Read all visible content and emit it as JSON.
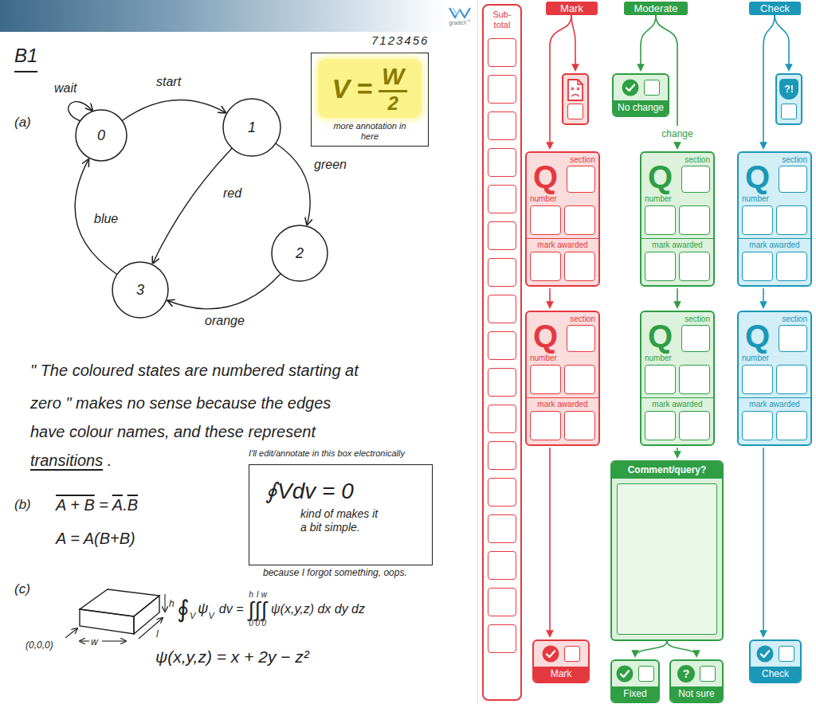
{
  "header": {
    "logo": "gradeX",
    "logo_mark": "™"
  },
  "script": {
    "question": "B1",
    "student_id": "7123456",
    "annotation": {
      "lhs": "V",
      "equals": "=",
      "numerator": "W",
      "denominator": "2",
      "note": "more annotation in here"
    },
    "part_a": {
      "label": "(a)",
      "states": [
        {
          "label": "0"
        },
        {
          "label": "1"
        },
        {
          "label": "2"
        },
        {
          "label": "3"
        }
      ],
      "transitions": [
        {
          "label": "wait",
          "from": "0",
          "to": "0"
        },
        {
          "label": "start",
          "from": "0",
          "to": "1"
        },
        {
          "label": "green",
          "from": "1",
          "to": "2"
        },
        {
          "label": "red",
          "from": "1",
          "to": "3"
        },
        {
          "label": "orange",
          "from": "2",
          "to": "3"
        },
        {
          "label": "blue",
          "from": "3",
          "to": "0"
        }
      ],
      "comment_lines": [
        [
          {
            "text": "\" The coloured states are numbered starting at",
            "underlined": false
          }
        ],
        [
          {
            "text": "zero \" makes no sense because the edges",
            "underlined": false
          }
        ],
        [
          {
            "text": "have colour names, and these represent",
            "underlined": false
          }
        ],
        [
          {
            "text": "transitions",
            "underlined": true
          },
          {
            "text": " .",
            "underlined": false
          }
        ]
      ]
    },
    "part_b": {
      "label": "(b)",
      "equations": [
        [
          {
            "text": "A + B",
            "overline": true
          },
          {
            "text": " = ",
            "overline": false
          },
          {
            "text": "A",
            "overline": true
          },
          {
            "text": ".",
            "overline": false
          },
          {
            "text": "B",
            "overline": true
          }
        ],
        [
          {
            "text": "A = A(B+B)",
            "overline": false
          }
        ]
      ]
    },
    "electronic_box": {
      "caption": "I'll edit/annotate in this box electronically",
      "formula": "∮Vdv = 0",
      "note_lines": [
        "kind of makes it",
        "a bit simple."
      ],
      "footnote": "because I forgot something, oops."
    },
    "part_c": {
      "label": "(c)",
      "origin": "(0,0,0)",
      "dims": {
        "width": "w",
        "height": "h",
        "length": "l"
      },
      "integral": {
        "sign": "∮",
        "domain": "V",
        "integrand": "ψ",
        "integrand_sub": "V",
        "differential": "dv =",
        "limits": [
          {
            "sign": "∫",
            "upper": "h",
            "lower": "0"
          },
          {
            "sign": "∫",
            "upper": "l",
            "lower": "0"
          },
          {
            "sign": "∫",
            "upper": "w",
            "lower": "0"
          }
        ],
        "body": "ψ(x,y,z) dx dy dz"
      },
      "definition": "ψ(x,y,z) = x + 2y − z²"
    }
  },
  "subtotal": {
    "title": "Sub-total",
    "boxes": [
      {
        "value": ""
      },
      {
        "value": ""
      },
      {
        "value": ""
      },
      {
        "value": ""
      },
      {
        "value": ""
      },
      {
        "value": ""
      },
      {
        "value": ""
      },
      {
        "value": ""
      },
      {
        "value": ""
      },
      {
        "value": ""
      },
      {
        "value": ""
      },
      {
        "value": ""
      },
      {
        "value": ""
      },
      {
        "value": ""
      },
      {
        "value": ""
      },
      {
        "value": ""
      },
      {
        "value": ""
      }
    ]
  },
  "mark": {
    "title": "Mark",
    "reject": {
      "checked": false
    },
    "questions": [
      {
        "section_label": "section",
        "letter": "Q",
        "number_label": "number",
        "mark_label": "mark awarded",
        "section": "",
        "number": [
          "",
          ""
        ],
        "mark": [
          "",
          ""
        ]
      },
      {
        "section_label": "section",
        "letter": "Q",
        "number_label": "number",
        "mark_label": "mark awarded",
        "section": "",
        "number": [
          "",
          ""
        ],
        "mark": [
          "",
          ""
        ]
      }
    ],
    "button": {
      "label": "Mark",
      "checked": false
    }
  },
  "moderate": {
    "title": "Moderate",
    "no_change": {
      "label": "No change",
      "checked": false
    },
    "change_label": "change",
    "questions": [
      {
        "section_label": "section",
        "letter": "Q",
        "number_label": "number",
        "mark_label": "mark awarded",
        "section": "",
        "number": [
          "",
          ""
        ],
        "mark": [
          "",
          ""
        ]
      },
      {
        "section_label": "section",
        "letter": "Q",
        "number_label": "number",
        "mark_label": "mark awarded",
        "section": "",
        "number": [
          "",
          ""
        ],
        "mark": [
          "",
          ""
        ]
      }
    ],
    "comment": {
      "title": "Comment/query?",
      "value": ""
    },
    "fixed": {
      "label": "Fixed",
      "checked": false
    },
    "not_sure": {
      "label": "Not sure",
      "icon": "?",
      "checked": false
    }
  },
  "check": {
    "title": "Check",
    "flag": {
      "icon": "?!",
      "checked": false
    },
    "questions": [
      {
        "section_label": "section",
        "letter": "Q",
        "number_label": "number",
        "mark_label": "mark awarded",
        "section": "",
        "number": [
          "",
          ""
        ],
        "mark": [
          "",
          ""
        ]
      },
      {
        "section_label": "section",
        "letter": "Q",
        "number_label": "number",
        "mark_label": "mark awarded",
        "section": "",
        "number": [
          "",
          ""
        ],
        "mark": [
          "",
          ""
        ]
      }
    ],
    "button": {
      "label": "Check",
      "checked": false
    }
  }
}
